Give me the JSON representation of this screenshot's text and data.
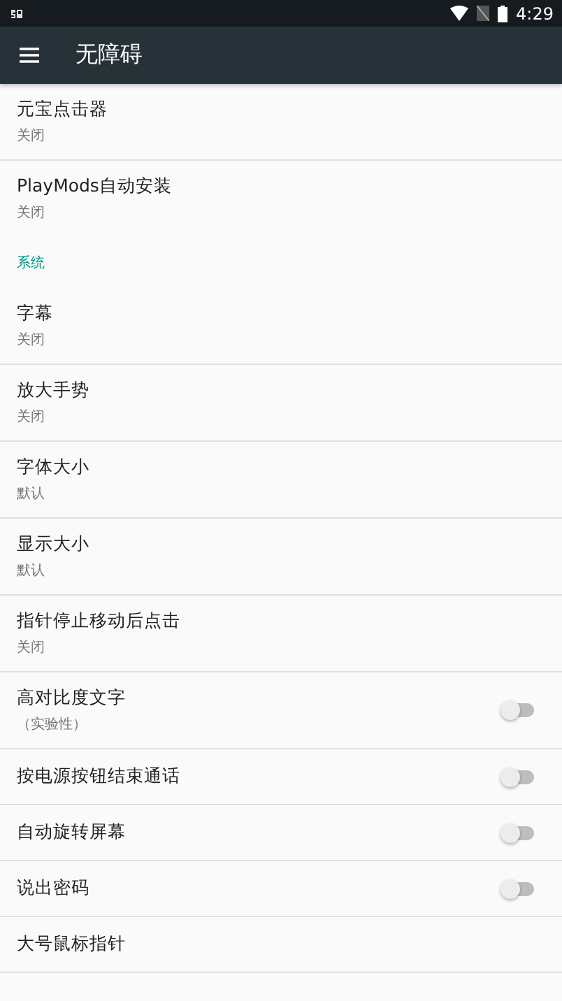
{
  "status_bar": {
    "time": "4:29"
  },
  "app_bar": {
    "title": "无障碍"
  },
  "items": [
    {
      "kind": "setting",
      "title": "元宝点击器",
      "summary": "关闭",
      "divider": true
    },
    {
      "kind": "setting",
      "title": "PlayMods自动安装",
      "summary": "关闭",
      "divider": false
    },
    {
      "kind": "section",
      "title": "系统"
    },
    {
      "kind": "setting",
      "title": "字幕",
      "summary": "关闭",
      "divider": true
    },
    {
      "kind": "setting",
      "title": "放大手势",
      "summary": "关闭",
      "divider": true
    },
    {
      "kind": "setting",
      "title": "字体大小",
      "summary": "默认",
      "divider": true
    },
    {
      "kind": "setting",
      "title": "显示大小",
      "summary": "默认",
      "divider": true
    },
    {
      "kind": "setting",
      "title": "指针停止移动后点击",
      "summary": "关闭",
      "divider": true
    },
    {
      "kind": "toggle",
      "title": "高对比度文字",
      "summary": "（实验性）",
      "on": false,
      "divider": true
    },
    {
      "kind": "toggle",
      "title": "按电源按钮结束通话",
      "on": false,
      "divider": true
    },
    {
      "kind": "toggle",
      "title": "自动旋转屏幕",
      "on": false,
      "divider": true
    },
    {
      "kind": "toggle",
      "title": "说出密码",
      "on": false,
      "divider": true
    },
    {
      "kind": "setting",
      "title": "大号鼠标指针",
      "divider": true
    }
  ]
}
